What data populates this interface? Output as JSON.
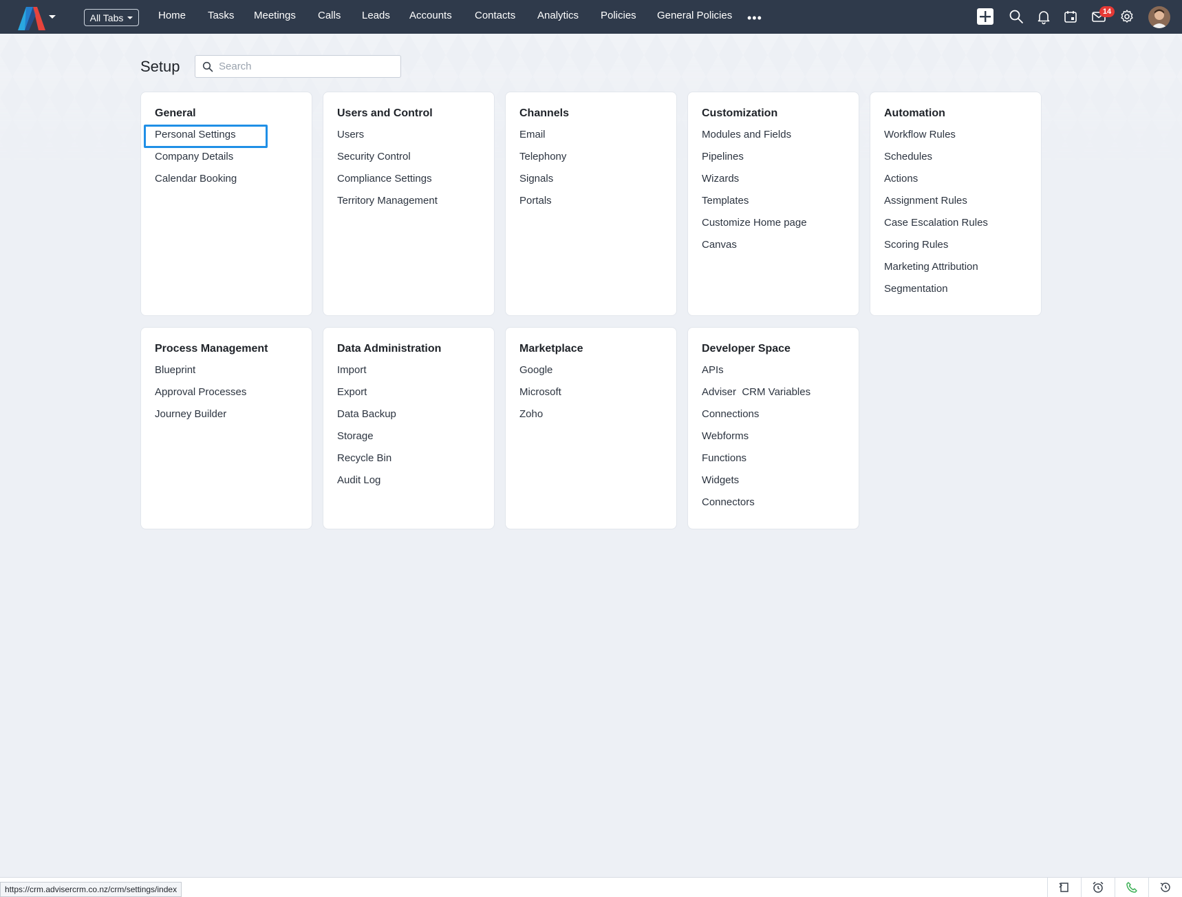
{
  "topbar": {
    "all_tabs_label": "All Tabs",
    "tabs": [
      "Home",
      "Tasks",
      "Meetings",
      "Calls",
      "Leads",
      "Accounts",
      "Contacts",
      "Analytics",
      "Policies",
      "General Policies"
    ],
    "more_label": "•••",
    "mail_badge_count": "14",
    "icons": [
      "plus-icon",
      "search-icon",
      "bell-icon",
      "calendar-icon",
      "mail-icon",
      "gear-icon"
    ]
  },
  "setup": {
    "title": "Setup",
    "search_placeholder": "Search",
    "cards": [
      {
        "title": "General",
        "items": [
          "Personal Settings",
          "Company Details",
          "Calendar Booking"
        ]
      },
      {
        "title": "Users and Control",
        "items": [
          "Users",
          "Security Control",
          "Compliance Settings",
          "Territory Management"
        ]
      },
      {
        "title": "Channels",
        "items": [
          "Email",
          "Telephony",
          "Signals",
          "Portals"
        ]
      },
      {
        "title": "Customization",
        "items": [
          "Modules and Fields",
          "Pipelines",
          "Wizards",
          "Templates",
          "Customize Home page",
          "Canvas"
        ]
      },
      {
        "title": "Automation",
        "items": [
          "Workflow Rules",
          "Schedules",
          "Actions",
          "Assignment Rules",
          "Case Escalation Rules",
          "Scoring Rules",
          "Marketing Attribution",
          "Segmentation"
        ]
      },
      {
        "title": "Process Management",
        "items": [
          "Blueprint",
          "Approval Processes",
          "Journey Builder"
        ]
      },
      {
        "title": "Data Administration",
        "items": [
          "Import",
          "Export",
          "Data Backup",
          "Storage",
          "Recycle Bin",
          "Audit Log"
        ]
      },
      {
        "title": "Marketplace",
        "items": [
          "Google",
          "Microsoft",
          "Zoho"
        ]
      },
      {
        "title": "Developer Space",
        "items": [
          "APIs",
          "Adviser  CRM Variables",
          "Connections",
          "Webforms",
          "Functions",
          "Widgets",
          "Connectors"
        ]
      }
    ]
  },
  "statusbar": {
    "url": "https://crm.advisercrm.co.nz/crm/settings/index",
    "icons": [
      "recent-items-icon",
      "alarm-clock-icon",
      "phone-icon",
      "history-icon"
    ]
  },
  "colors": {
    "topbar_bg": "#2f3a4b",
    "page_bg": "#edf0f5",
    "focus_ring": "#1f8fe6",
    "badge": "#e53935",
    "phone_green": "#3cb055"
  }
}
